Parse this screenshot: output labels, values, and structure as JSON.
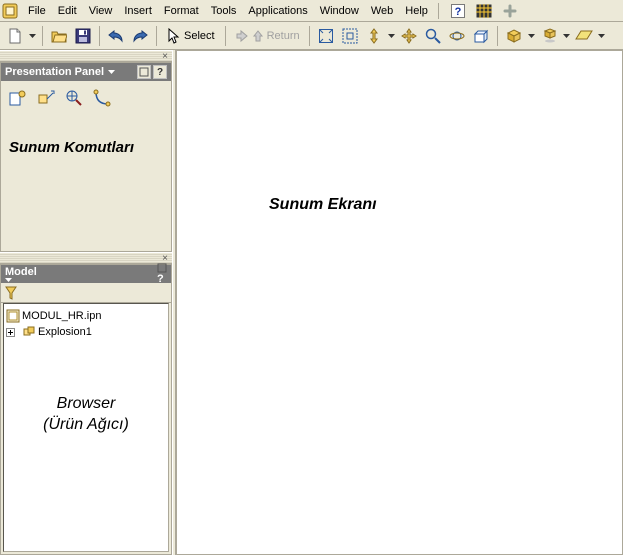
{
  "menu": {
    "items": [
      "File",
      "Edit",
      "View",
      "Insert",
      "Format",
      "Tools",
      "Applications",
      "Window",
      "Web",
      "Help"
    ]
  },
  "toolbar": {
    "select_label": "Select",
    "return_label": "Return"
  },
  "presentation_panel": {
    "title": "Presentation Panel",
    "body_label": "Sunum Komutları"
  },
  "model_panel": {
    "title": "Model",
    "tree": {
      "root": "MODUL_HR.ipn",
      "child": "Explosion1"
    },
    "browser_label_line1": "Browser",
    "browser_label_line2": "(Ürün Ağıcı)"
  },
  "canvas": {
    "label": "Sunum Ekranı"
  },
  "icons": {
    "app": "inventor-app-icon",
    "help_q": "?",
    "close_x": "×"
  }
}
